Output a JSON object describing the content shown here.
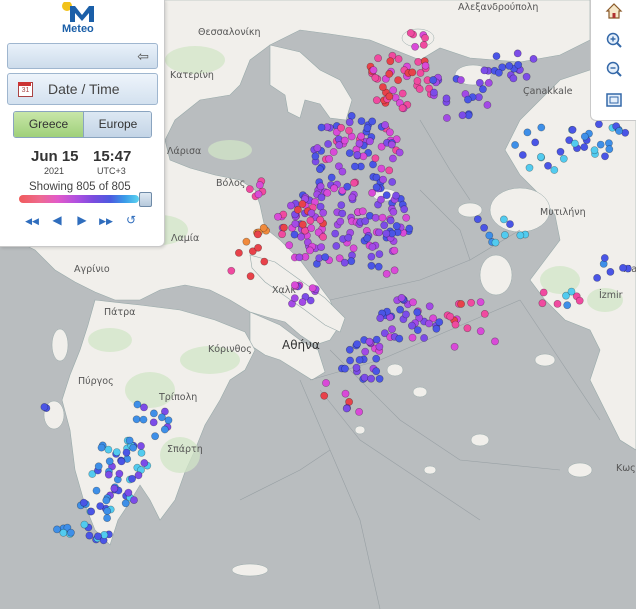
{
  "app": {
    "logo_text": "Meteo"
  },
  "panel": {
    "date_time_label": "Date / Time",
    "calendar_day": "31",
    "tabs": [
      {
        "label": "Greece",
        "active": true
      },
      {
        "label": "Europe",
        "active": false
      }
    ],
    "date": "Jun 15",
    "year": "2021",
    "time": "15:47",
    "timezone": "UTC+3",
    "showing": "Showing 805 of 805",
    "scale_colors": [
      "#f05a5a",
      "#ee6a92",
      "#e25ac8",
      "#b050e0",
      "#7a4cdf",
      "#4c5ae0",
      "#3a9be8",
      "#5cd3f0"
    ],
    "playback": [
      {
        "name": "rewind-fast-icon",
        "glyph": "◀◀"
      },
      {
        "name": "step-back-icon",
        "glyph": "◀"
      },
      {
        "name": "step-forward-icon",
        "glyph": "▶"
      },
      {
        "name": "forward-fast-icon",
        "glyph": "▶▶"
      },
      {
        "name": "reset-icon",
        "glyph": "↺"
      }
    ]
  },
  "zoom_controls": [
    {
      "name": "home-icon"
    },
    {
      "name": "zoom-in-icon"
    },
    {
      "name": "zoom-out-icon"
    },
    {
      "name": "zoom-extent-icon"
    }
  ],
  "map_labels": {
    "alexandroupoli": "Αλεξανδρούπολη",
    "thessaloniki": "Θεσσαλονίκη",
    "katerini": "Κατερίνη",
    "larisa": "Λάρισα",
    "volos": "Βόλος",
    "lamia": "Λαμία",
    "agrinio": "Αγρίνιο",
    "chalkida": "Χαλκ",
    "patra": "Πάτρα",
    "korinthos": "Κόρινθος",
    "athina": "Αθήνα",
    "pyrgos": "Πύργος",
    "tripoli": "Τρίπολη",
    "sparti": "Σπάρτη",
    "canakkale": "Çanakkale",
    "mytilini": "Μυτιλήνη",
    "izmir": "İzmir",
    "kos": "Κως",
    "ma": "Ma"
  },
  "lightning_colors": {
    "red": "#e8424a",
    "orange": "#f08a3c",
    "pink": "#f04aa0",
    "magenta": "#d94ad8",
    "purple": "#a34ae6",
    "violet": "#7c4ce8",
    "blue": "#4a55e6",
    "sky": "#3e8fe8",
    "cyan": "#52cbef"
  }
}
